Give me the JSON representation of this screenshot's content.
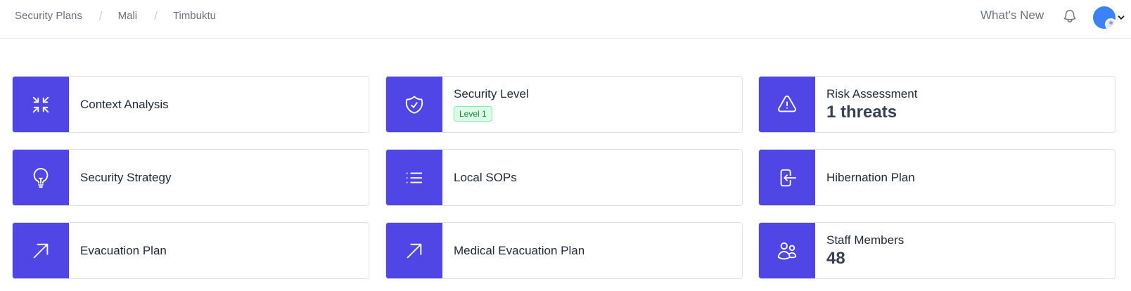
{
  "breadcrumb": {
    "items": [
      "Security Plans",
      "Mali",
      "Timbuktu"
    ],
    "separator": "/"
  },
  "header": {
    "whats_new": "What's New",
    "bell_icon": "bell-icon",
    "avatar_color": "#3b82f6"
  },
  "accent_color": "#4f46e5",
  "cards": [
    {
      "title": "Context Analysis",
      "icon": "compress-arrows-icon"
    },
    {
      "title": "Security Level",
      "icon": "shield-check-icon",
      "badge": "Level 1"
    },
    {
      "title": "Risk Assessment",
      "icon": "warning-triangle-icon",
      "value": "1 threats"
    },
    {
      "title": "Security Strategy",
      "icon": "lightbulb-icon"
    },
    {
      "title": "Local SOPs",
      "icon": "list-icon"
    },
    {
      "title": "Hibernation Plan",
      "icon": "login-arrow-icon"
    },
    {
      "title": "Evacuation Plan",
      "icon": "arrow-up-right-icon"
    },
    {
      "title": "Medical Evacuation Plan",
      "icon": "arrow-up-right-icon"
    },
    {
      "title": "Staff Members",
      "icon": "users-icon",
      "value": "48"
    }
  ]
}
